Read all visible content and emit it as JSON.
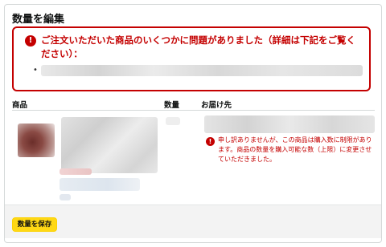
{
  "page": {
    "title": "数量を編集"
  },
  "alert": {
    "icon": "alert-icon",
    "icon_glyph": "!",
    "message": "ご注文いただいた商品のいくつかに問題がありました（詳細は下記をご覧ください）：",
    "bullet": "•",
    "color": "#c40000"
  },
  "table": {
    "headers": {
      "product": "商品",
      "quantity": "数量",
      "delivery": "お届け先"
    }
  },
  "row": {
    "error_icon": "alert-icon",
    "error_glyph": "!",
    "error_message": "申し訳ありませんが、この商品は購入数に制限があります。商品の数量を購入可能な数（上限）に変更させていただきました。"
  },
  "footer": {
    "save_label": "数量を保存",
    "button_color": "#ffd814"
  }
}
